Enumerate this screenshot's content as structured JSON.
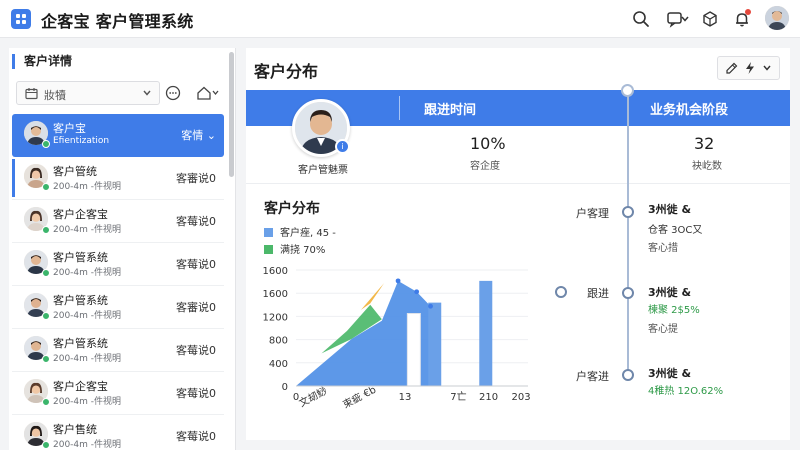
{
  "header": {
    "app_title": "企客宝 客户管理系统",
    "icons": [
      "search-icon",
      "message-icon",
      "chevron-down-icon",
      "cube-icon",
      "bell-icon",
      "user-avatar"
    ],
    "brand_color": "#3f7ce8"
  },
  "sidebar": {
    "title": "客户详情",
    "filter": {
      "value": "妝犢",
      "icon": "calendar-icon"
    },
    "customers": [
      {
        "name": "客户宝",
        "sub": "Efientization",
        "tag": "客情 ⌄",
        "active": true
      },
      {
        "name": "客户管统",
        "sub": "200-4m -件视明",
        "tag": "客審说0",
        "active": false
      },
      {
        "name": "客户企客宝",
        "sub": "200-4m -件视明",
        "tag": "客莓说0",
        "active": false
      },
      {
        "name": "客户管系统",
        "sub": "200-4m -件视明",
        "tag": "客莓说0",
        "active": false
      },
      {
        "name": "客户管系统",
        "sub": "200-4m -件视明",
        "tag": "客審说0",
        "active": false
      },
      {
        "name": "客户管系统",
        "sub": "200-4m -件视明",
        "tag": "客莓说0",
        "active": false
      },
      {
        "name": "客户企客宝",
        "sub": "200-4m -件视明",
        "tag": "客莓说0",
        "active": false
      },
      {
        "name": "客户售统",
        "sub": "200-4m -件视明",
        "tag": "客莓说0",
        "active": false
      }
    ]
  },
  "main": {
    "title": "客户分布",
    "tabs": [
      "跟进时间",
      "业务机会阶段"
    ],
    "profile_name": "客户管魅票",
    "stats": [
      {
        "value": "10%",
        "label": "容企度"
      },
      {
        "value": "32",
        "label": "袂屹数"
      }
    ]
  },
  "chart_data": {
    "type": "area",
    "title": "客户分布",
    "legend": [
      {
        "label": "客户痤, 45 -",
        "color": "#6aa0e8"
      },
      {
        "label": "满挠 70%",
        "color": "#4cb86a"
      }
    ],
    "x_tick_labels": [
      "0",
      "文刼鯋",
      "束疵 €b",
      "13",
      "7亡",
      "210",
      "203"
    ],
    "y_tick_labels": [
      "1600",
      "1600",
      "1200",
      "800",
      "400",
      "0"
    ],
    "ylim": [
      0,
      1600
    ],
    "areas": [
      {
        "name": "blue-area",
        "color": "#4f8fe6",
        "points": [
          [
            0.0,
            0
          ],
          [
            0.24,
            650
          ],
          [
            0.37,
            900
          ],
          [
            0.44,
            1450
          ],
          [
            0.52,
            1300
          ],
          [
            0.58,
            1100
          ],
          [
            0.62,
            0
          ]
        ]
      },
      {
        "name": "green-area",
        "color": "#4cb86a",
        "points": [
          [
            0.11,
            450
          ],
          [
            0.22,
            760
          ],
          [
            0.32,
            1120
          ],
          [
            0.37,
            920
          ],
          [
            0.24,
            650
          ]
        ]
      },
      {
        "name": "orange-area",
        "color": "#f1b23a",
        "points": [
          [
            0.28,
            1050
          ],
          [
            0.38,
            1420
          ],
          [
            0.32,
            1140
          ]
        ]
      }
    ],
    "bars": [
      {
        "name": "bar-1",
        "x": 0.48,
        "value": 1000,
        "color": "#ffffff"
      },
      {
        "name": "bar-2",
        "x": 0.57,
        "value": 1150,
        "color": "#6aa0e8"
      },
      {
        "name": "bar-3",
        "x": 0.79,
        "value": 1450,
        "color": "#6aa0e8"
      }
    ]
  },
  "timeline": [
    {
      "label": "户客理",
      "line1": "3州徙 &",
      "line2": "仓客 3OC又",
      "line3": "客心措"
    },
    {
      "label": "跟进",
      "line1": "3州徙 &",
      "line2": "楝聚 2$5%",
      "line3": "客心提"
    },
    {
      "label": "户客进",
      "line1": "3州徙 &",
      "line2": "4稚热 12O.62%",
      "line3": ""
    }
  ]
}
